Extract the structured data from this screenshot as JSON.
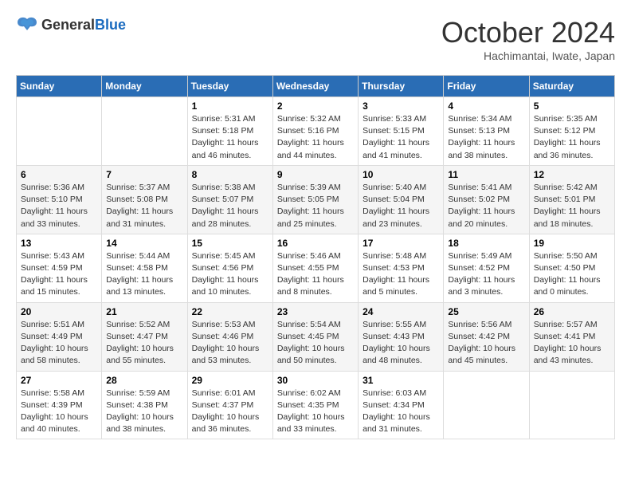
{
  "header": {
    "logo_general": "General",
    "logo_blue": "Blue",
    "month_year": "October 2024",
    "location": "Hachimantai, Iwate, Japan"
  },
  "weekdays": [
    "Sunday",
    "Monday",
    "Tuesday",
    "Wednesday",
    "Thursday",
    "Friday",
    "Saturday"
  ],
  "weeks": [
    [
      {
        "day": "",
        "sunrise": "",
        "sunset": "",
        "daylight": ""
      },
      {
        "day": "",
        "sunrise": "",
        "sunset": "",
        "daylight": ""
      },
      {
        "day": "1",
        "sunrise": "Sunrise: 5:31 AM",
        "sunset": "Sunset: 5:18 PM",
        "daylight": "Daylight: 11 hours and 46 minutes."
      },
      {
        "day": "2",
        "sunrise": "Sunrise: 5:32 AM",
        "sunset": "Sunset: 5:16 PM",
        "daylight": "Daylight: 11 hours and 44 minutes."
      },
      {
        "day": "3",
        "sunrise": "Sunrise: 5:33 AM",
        "sunset": "Sunset: 5:15 PM",
        "daylight": "Daylight: 11 hours and 41 minutes."
      },
      {
        "day": "4",
        "sunrise": "Sunrise: 5:34 AM",
        "sunset": "Sunset: 5:13 PM",
        "daylight": "Daylight: 11 hours and 38 minutes."
      },
      {
        "day": "5",
        "sunrise": "Sunrise: 5:35 AM",
        "sunset": "Sunset: 5:12 PM",
        "daylight": "Daylight: 11 hours and 36 minutes."
      }
    ],
    [
      {
        "day": "6",
        "sunrise": "Sunrise: 5:36 AM",
        "sunset": "Sunset: 5:10 PM",
        "daylight": "Daylight: 11 hours and 33 minutes."
      },
      {
        "day": "7",
        "sunrise": "Sunrise: 5:37 AM",
        "sunset": "Sunset: 5:08 PM",
        "daylight": "Daylight: 11 hours and 31 minutes."
      },
      {
        "day": "8",
        "sunrise": "Sunrise: 5:38 AM",
        "sunset": "Sunset: 5:07 PM",
        "daylight": "Daylight: 11 hours and 28 minutes."
      },
      {
        "day": "9",
        "sunrise": "Sunrise: 5:39 AM",
        "sunset": "Sunset: 5:05 PM",
        "daylight": "Daylight: 11 hours and 25 minutes."
      },
      {
        "day": "10",
        "sunrise": "Sunrise: 5:40 AM",
        "sunset": "Sunset: 5:04 PM",
        "daylight": "Daylight: 11 hours and 23 minutes."
      },
      {
        "day": "11",
        "sunrise": "Sunrise: 5:41 AM",
        "sunset": "Sunset: 5:02 PM",
        "daylight": "Daylight: 11 hours and 20 minutes."
      },
      {
        "day": "12",
        "sunrise": "Sunrise: 5:42 AM",
        "sunset": "Sunset: 5:01 PM",
        "daylight": "Daylight: 11 hours and 18 minutes."
      }
    ],
    [
      {
        "day": "13",
        "sunrise": "Sunrise: 5:43 AM",
        "sunset": "Sunset: 4:59 PM",
        "daylight": "Daylight: 11 hours and 15 minutes."
      },
      {
        "day": "14",
        "sunrise": "Sunrise: 5:44 AM",
        "sunset": "Sunset: 4:58 PM",
        "daylight": "Daylight: 11 hours and 13 minutes."
      },
      {
        "day": "15",
        "sunrise": "Sunrise: 5:45 AM",
        "sunset": "Sunset: 4:56 PM",
        "daylight": "Daylight: 11 hours and 10 minutes."
      },
      {
        "day": "16",
        "sunrise": "Sunrise: 5:46 AM",
        "sunset": "Sunset: 4:55 PM",
        "daylight": "Daylight: 11 hours and 8 minutes."
      },
      {
        "day": "17",
        "sunrise": "Sunrise: 5:48 AM",
        "sunset": "Sunset: 4:53 PM",
        "daylight": "Daylight: 11 hours and 5 minutes."
      },
      {
        "day": "18",
        "sunrise": "Sunrise: 5:49 AM",
        "sunset": "Sunset: 4:52 PM",
        "daylight": "Daylight: 11 hours and 3 minutes."
      },
      {
        "day": "19",
        "sunrise": "Sunrise: 5:50 AM",
        "sunset": "Sunset: 4:50 PM",
        "daylight": "Daylight: 11 hours and 0 minutes."
      }
    ],
    [
      {
        "day": "20",
        "sunrise": "Sunrise: 5:51 AM",
        "sunset": "Sunset: 4:49 PM",
        "daylight": "Daylight: 10 hours and 58 minutes."
      },
      {
        "day": "21",
        "sunrise": "Sunrise: 5:52 AM",
        "sunset": "Sunset: 4:47 PM",
        "daylight": "Daylight: 10 hours and 55 minutes."
      },
      {
        "day": "22",
        "sunrise": "Sunrise: 5:53 AM",
        "sunset": "Sunset: 4:46 PM",
        "daylight": "Daylight: 10 hours and 53 minutes."
      },
      {
        "day": "23",
        "sunrise": "Sunrise: 5:54 AM",
        "sunset": "Sunset: 4:45 PM",
        "daylight": "Daylight: 10 hours and 50 minutes."
      },
      {
        "day": "24",
        "sunrise": "Sunrise: 5:55 AM",
        "sunset": "Sunset: 4:43 PM",
        "daylight": "Daylight: 10 hours and 48 minutes."
      },
      {
        "day": "25",
        "sunrise": "Sunrise: 5:56 AM",
        "sunset": "Sunset: 4:42 PM",
        "daylight": "Daylight: 10 hours and 45 minutes."
      },
      {
        "day": "26",
        "sunrise": "Sunrise: 5:57 AM",
        "sunset": "Sunset: 4:41 PM",
        "daylight": "Daylight: 10 hours and 43 minutes."
      }
    ],
    [
      {
        "day": "27",
        "sunrise": "Sunrise: 5:58 AM",
        "sunset": "Sunset: 4:39 PM",
        "daylight": "Daylight: 10 hours and 40 minutes."
      },
      {
        "day": "28",
        "sunrise": "Sunrise: 5:59 AM",
        "sunset": "Sunset: 4:38 PM",
        "daylight": "Daylight: 10 hours and 38 minutes."
      },
      {
        "day": "29",
        "sunrise": "Sunrise: 6:01 AM",
        "sunset": "Sunset: 4:37 PM",
        "daylight": "Daylight: 10 hours and 36 minutes."
      },
      {
        "day": "30",
        "sunrise": "Sunrise: 6:02 AM",
        "sunset": "Sunset: 4:35 PM",
        "daylight": "Daylight: 10 hours and 33 minutes."
      },
      {
        "day": "31",
        "sunrise": "Sunrise: 6:03 AM",
        "sunset": "Sunset: 4:34 PM",
        "daylight": "Daylight: 10 hours and 31 minutes."
      },
      {
        "day": "",
        "sunrise": "",
        "sunset": "",
        "daylight": ""
      },
      {
        "day": "",
        "sunrise": "",
        "sunset": "",
        "daylight": ""
      }
    ]
  ]
}
